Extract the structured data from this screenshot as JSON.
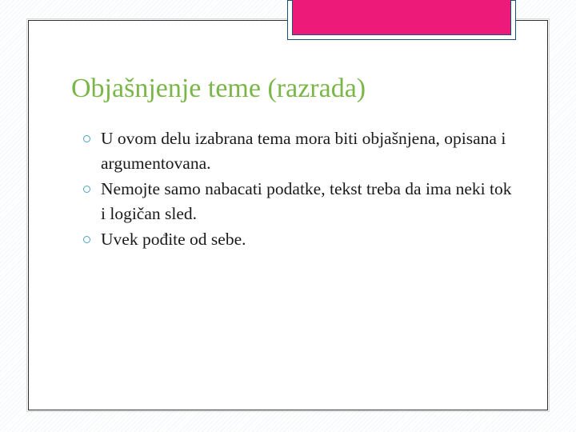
{
  "slide": {
    "title": "Objašnjenje teme (razrada)",
    "bullets": [
      {
        "text": "U ovom delu izabrana tema mora biti objašnjena, opisana i argumentovana."
      },
      {
        "text": "Nemojte samo nabacati podatke, tekst treba da ima neki tok i logičan sled."
      },
      {
        "text": "Uvek pođite od sebe."
      }
    ]
  },
  "colors": {
    "title": "#7ab648",
    "accent_tab": "#ee1a79",
    "tab_border": "#1f4e79",
    "bullet_icon": "#4ba3c7",
    "body_text": "#1a1a1a"
  },
  "icons": {
    "bullet": "circle-bullet-icon"
  }
}
